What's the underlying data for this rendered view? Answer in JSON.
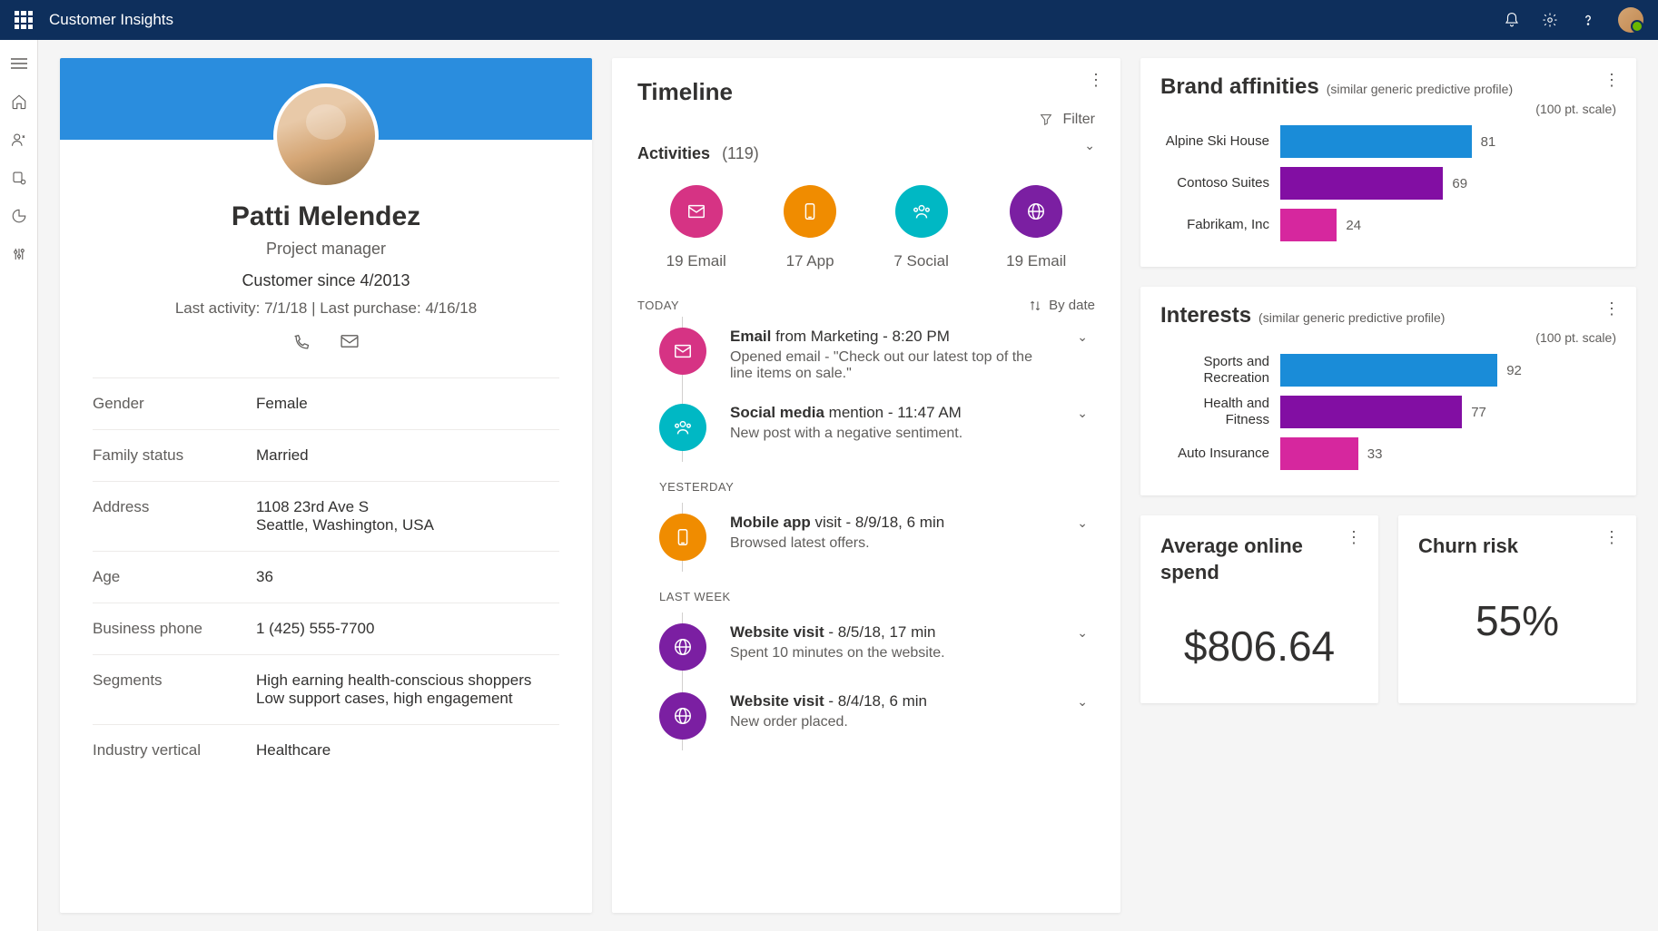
{
  "app": {
    "title": "Customer Insights"
  },
  "profile": {
    "name": "Patti Melendez",
    "role": "Project manager",
    "since": "Customer since 4/2013",
    "meta": "Last activity: 7/1/18  |  Last purchase: 4/16/18",
    "details": [
      {
        "label": "Gender",
        "value": "Female"
      },
      {
        "label": "Family status",
        "value": "Married"
      },
      {
        "label": "Address",
        "value": "1108 23rd Ave S\nSeattle, Washington, USA"
      },
      {
        "label": "Age",
        "value": "36"
      },
      {
        "label": "Business phone",
        "value": "1 (425) 555-7700"
      },
      {
        "label": "Segments",
        "value": "High earning health-conscious shoppers\nLow support cases, high engagement"
      },
      {
        "label": "Industry vertical",
        "value": "Healthcare"
      }
    ]
  },
  "timeline": {
    "title": "Timeline",
    "filter_label": "Filter",
    "activities_label": "Activities",
    "activities_count": "(119)",
    "sort_label": "By date",
    "tiles": [
      {
        "label": "19 Email",
        "color": "#d63384",
        "icon": "mail"
      },
      {
        "label": "17 App",
        "color": "#f08c00",
        "icon": "phone"
      },
      {
        "label": "7 Social",
        "color": "#00b8c4",
        "icon": "people"
      },
      {
        "label": "19 Email",
        "color": "#7b1fa2",
        "icon": "globe"
      }
    ],
    "groups": [
      {
        "period": "TODAY",
        "items": [
          {
            "color": "#d63384",
            "icon": "mail",
            "title_pre": "Email",
            "title_post": " from Marketing - 8:20 PM",
            "desc": "Opened  email - \"Check out our latest top of the line items on sale.\""
          },
          {
            "color": "#00b8c4",
            "icon": "people",
            "title_pre": "Social media",
            "title_post": " mention - 11:47 AM",
            "desc": "New post with a negative sentiment."
          }
        ]
      },
      {
        "period": "YESTERDAY",
        "items": [
          {
            "color": "#f08c00",
            "icon": "phone",
            "title_pre": "Mobile app",
            "title_post": " visit - 8/9/18, 6 min",
            "desc": "Browsed latest offers."
          }
        ]
      },
      {
        "period": "LAST WEEK",
        "items": [
          {
            "color": "#7b1fa2",
            "icon": "globe",
            "title_pre": "Website visit",
            "title_post": " - 8/5/18, 17 min",
            "desc": "Spent 10 minutes on the website."
          },
          {
            "color": "#7b1fa2",
            "icon": "globe",
            "title_pre": "Website visit",
            "title_post": " - 8/4/18, 6 min",
            "desc": "New order placed."
          }
        ]
      }
    ]
  },
  "brand": {
    "title": "Brand affinities",
    "sub": "(similar generic predictive profile)",
    "scale": "(100 pt. scale)"
  },
  "interests": {
    "title": "Interests",
    "sub": "(similar generic predictive profile)",
    "scale": "(100 pt. scale)"
  },
  "kpi": {
    "spend_title": "Average online spend",
    "spend_value": "$806.64",
    "churn_title": "Churn risk",
    "churn_value": "55%"
  },
  "chart_data": [
    {
      "type": "bar",
      "title": "Brand affinities",
      "subtitle": "(similar generic predictive profile)",
      "xlabel": "",
      "ylabel": "",
      "ylim": [
        0,
        100
      ],
      "categories": [
        "Alpine Ski House",
        "Contoso Suites",
        "Fabrikam, Inc"
      ],
      "values": [
        81,
        69,
        24
      ],
      "colors": [
        "#1a8cd8",
        "#820ea3",
        "#d6279e"
      ]
    },
    {
      "type": "bar",
      "title": "Interests",
      "subtitle": "(similar generic predictive profile)",
      "xlabel": "",
      "ylabel": "",
      "ylim": [
        0,
        100
      ],
      "categories": [
        "Sports and Recreation",
        "Health and Fitness",
        "Auto Insurance"
      ],
      "values": [
        92,
        77,
        33
      ],
      "colors": [
        "#1a8cd8",
        "#820ea3",
        "#d6279e"
      ]
    }
  ]
}
